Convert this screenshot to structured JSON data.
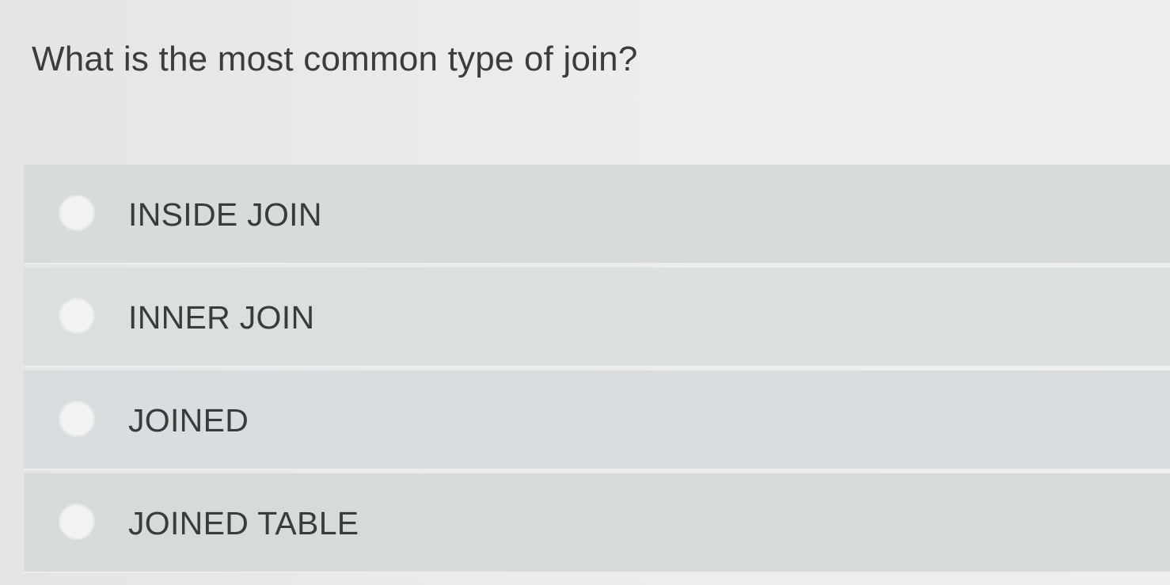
{
  "question": {
    "text": "What is the most common type of join?"
  },
  "options": [
    {
      "label": "INSIDE JOIN"
    },
    {
      "label": "INNER JOIN"
    },
    {
      "label": "JOINED"
    },
    {
      "label": "JOINED TABLE"
    }
  ]
}
